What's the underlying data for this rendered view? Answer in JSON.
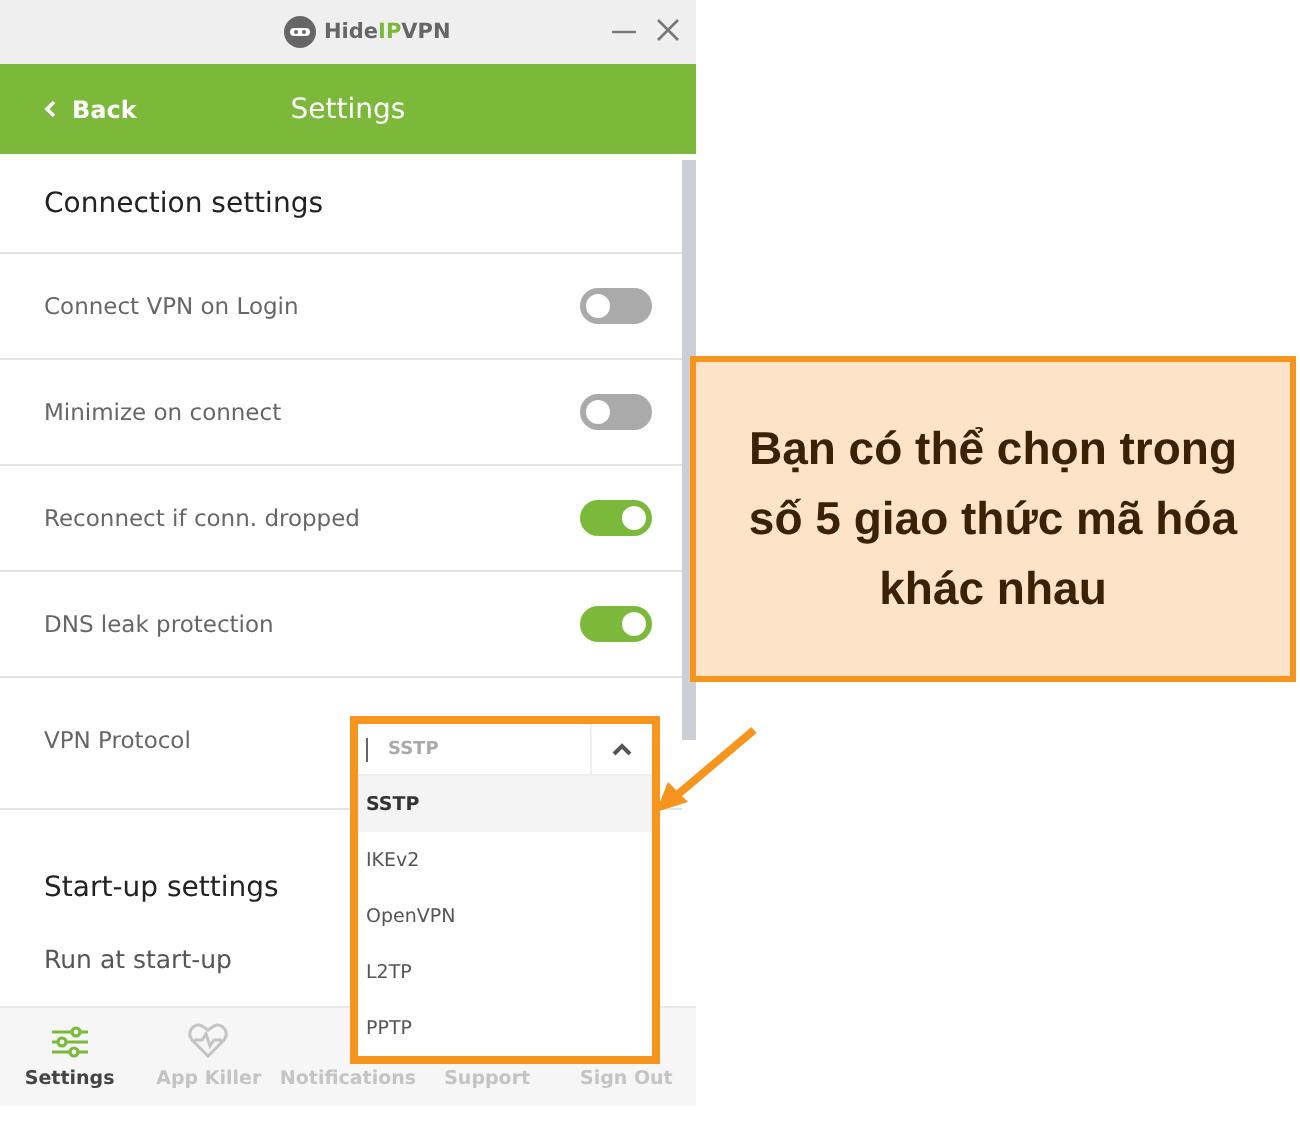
{
  "window": {
    "brand": {
      "prefix": "Hide",
      "highlight": "IP",
      "suffix": "VPN"
    }
  },
  "header": {
    "back": "Back",
    "title": "Settings"
  },
  "sections": [
    {
      "heading": "Connection settings",
      "rows": [
        {
          "kind": "toggle",
          "label": "Connect VPN on Login",
          "on": false
        },
        {
          "kind": "toggle",
          "label": "Minimize on connect",
          "on": false
        },
        {
          "kind": "toggle",
          "label": "Reconnect if conn. dropped",
          "on": true
        },
        {
          "kind": "toggle",
          "label": "DNS leak protection",
          "on": true
        },
        {
          "kind": "dropdown",
          "label": "VPN Protocol",
          "value": "SSTP",
          "expanded": true,
          "options": [
            {
              "label": "SSTP",
              "selected": true
            },
            {
              "label": "IKEv2",
              "selected": false
            },
            {
              "label": "OpenVPN",
              "selected": false
            },
            {
              "label": "L2TP",
              "selected": false
            },
            {
              "label": "PPTP",
              "selected": false
            }
          ]
        }
      ]
    },
    {
      "heading": "Start-up settings",
      "rows": [
        {
          "kind": "text",
          "label": "Run at start-up"
        }
      ]
    }
  ],
  "nav": [
    {
      "label": "Settings",
      "selected": true
    },
    {
      "label": "App Killer",
      "selected": false
    },
    {
      "label": "Notifications",
      "selected": false
    },
    {
      "label": "Support",
      "selected": false
    },
    {
      "label": "Sign Out",
      "selected": false
    }
  ],
  "callout": {
    "text": "Bạn có thể chọn trong số 5 giao thức mã hóa khác nhau"
  }
}
